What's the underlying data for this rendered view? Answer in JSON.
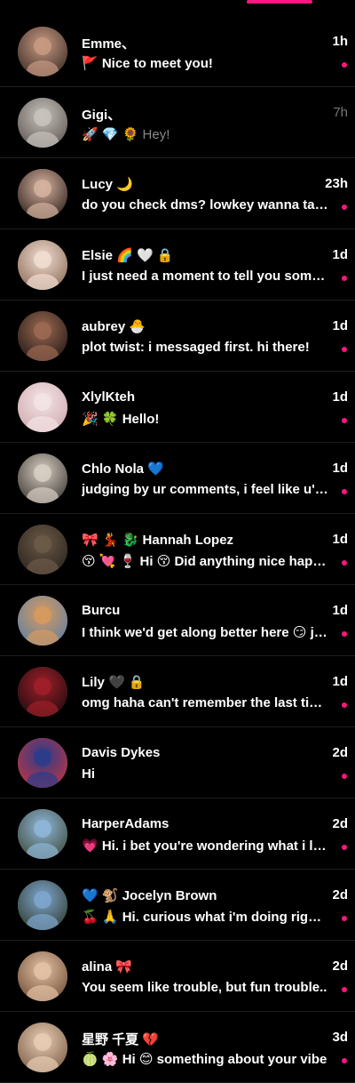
{
  "colors": {
    "accent": "#f91880",
    "background": "#000000",
    "read_text": "#888888"
  },
  "conversations": [
    {
      "name": "Emme、",
      "time": "1h",
      "message": "🚩 Nice to meet you!",
      "unread": true,
      "avatar_colors": [
        "#c89a82",
        "#3a2a24"
      ]
    },
    {
      "name": "Gigi、",
      "time": "7h",
      "message": "🚀 💎 🌻 Hey!",
      "unread": false,
      "avatar_colors": [
        "#c9c3bd",
        "#5b5450"
      ]
    },
    {
      "name": "Lucy 🌙",
      "time": "23h",
      "message": "do you check dms? lowkey wanna talk to you",
      "unread": true,
      "avatar_colors": [
        "#d6b3a0",
        "#2b1d18"
      ]
    },
    {
      "name": "Elsie 🌈 🤍 🔒",
      "time": "1d",
      "message": "I just need a moment to tell you something",
      "unread": true,
      "avatar_colors": [
        "#f1ddd1",
        "#8a6a55"
      ]
    },
    {
      "name": "aubrey 🐣",
      "time": "1d",
      "message": "plot twist: i messaged first. hi there!",
      "unread": true,
      "avatar_colors": [
        "#9c6a53",
        "#1f1612"
      ]
    },
    {
      "name": "XlylKteh",
      "time": "1d",
      "message": "🎉 🍀 Hello!",
      "unread": true,
      "avatar_colors": [
        "#f3e4e6",
        "#cfa8ad"
      ]
    },
    {
      "name": "Chlo Nola 💙",
      "time": "1d",
      "message": "judging by ur comments, i feel like u'd be fun",
      "unread": true,
      "avatar_colors": [
        "#d8cfc4",
        "#3a3530"
      ]
    },
    {
      "name": "🎀 💃 🐉 Hannah Lopez",
      "time": "1d",
      "message": "😚 💘 🍷 Hi 😚 Did anything nice happen today?",
      "unread": true,
      "avatar_colors": [
        "#6b5a48",
        "#2a221b"
      ]
    },
    {
      "name": "Burcu",
      "time": "1d",
      "message": "I think we'd get along better here 😏 just saying",
      "unread": true,
      "avatar_colors": [
        "#d89a5e",
        "#5a7fa8"
      ]
    },
    {
      "name": "Lily 🖤 🔒",
      "time": "1d",
      "message": "omg haha can't remember the last time i did this",
      "unread": true,
      "avatar_colors": [
        "#a01f2a",
        "#1a0a0c"
      ]
    },
    {
      "name": "Davis Dykes",
      "time": "2d",
      "message": "Hi",
      "unread": true,
      "avatar_colors": [
        "#2a3c8c",
        "#c7343d"
      ]
    },
    {
      "name": "HarperAdams",
      "time": "2d",
      "message": "💗 Hi. i bet you're wondering what i look like",
      "unread": true,
      "avatar_colors": [
        "#8fb6d9",
        "#3d4a38"
      ]
    },
    {
      "name": "💙 🐒 Jocelyn Brown",
      "time": "2d",
      "message": "🍒 🙏 Hi. curious what i'm doing right now?",
      "unread": true,
      "avatar_colors": [
        "#7fa6cf",
        "#2e3b2c"
      ]
    },
    {
      "name": "alina 🎀",
      "time": "2d",
      "message": "You seem like trouble, but fun trouble..",
      "unread": true,
      "avatar_colors": [
        "#e3c2a5",
        "#6e4a33"
      ]
    },
    {
      "name": "星野 千夏 💔",
      "time": "3d",
      "message": "🍈 🌸 Hi 😊 something about your vibe",
      "unread": true,
      "avatar_colors": [
        "#e8cdb4",
        "#7a5a44"
      ]
    }
  ]
}
